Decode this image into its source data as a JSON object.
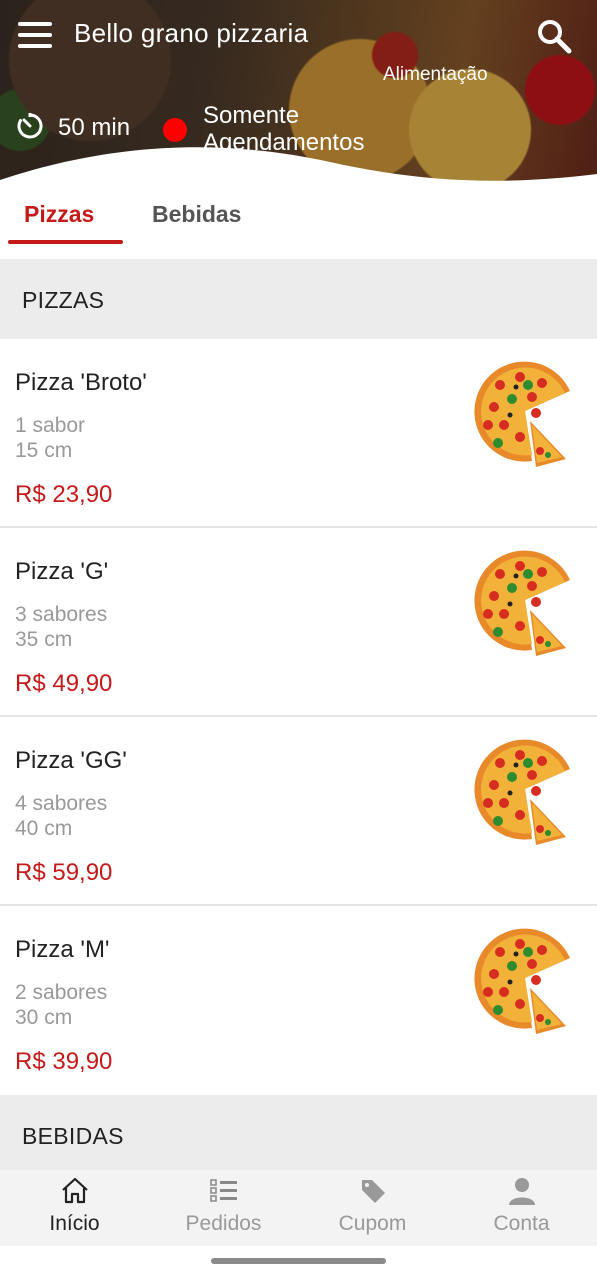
{
  "app": {
    "title": "Bello grano pizzaria",
    "eta": "50 min",
    "status_line1": "Somente",
    "status_line2": "Agendamentos",
    "category_tag": "Alimentação"
  },
  "tabs": [
    {
      "label": "Pizzas",
      "active": true
    },
    {
      "label": "Bebidas",
      "active": false
    }
  ],
  "sections": {
    "pizzas_title": "PIZZAS",
    "bebidas_title": "BEBIDAS"
  },
  "products": [
    {
      "name": "Pizza 'Broto'",
      "flavors": "1 sabor",
      "size": "15 cm",
      "price": "R$ 23,90",
      "icon": "pizza-image"
    },
    {
      "name": "Pizza 'G'",
      "flavors": "3 sabores",
      "size": "35 cm",
      "price": "R$ 49,90",
      "icon": "pizza-image"
    },
    {
      "name": "Pizza 'GG'",
      "flavors": "4 sabores",
      "size": "40 cm",
      "price": "R$ 59,90",
      "icon": "pizza-image"
    },
    {
      "name": "Pizza 'M'",
      "flavors": "2 sabores",
      "size": "30 cm",
      "price": "R$ 39,90",
      "icon": "pizza-image"
    }
  ],
  "bottom_nav": [
    {
      "label": "Início",
      "icon": "home-icon",
      "active": true
    },
    {
      "label": "Pedidos",
      "icon": "order-list-icon",
      "active": false
    },
    {
      "label": "Cupom",
      "icon": "coupon-tag-icon",
      "active": false
    },
    {
      "label": "Conta",
      "icon": "user-icon",
      "active": false
    }
  ],
  "colors": {
    "accent": "#c41a1a",
    "status_dot": "#ff0000",
    "muted_text": "#999999",
    "section_bg": "#ececec"
  }
}
